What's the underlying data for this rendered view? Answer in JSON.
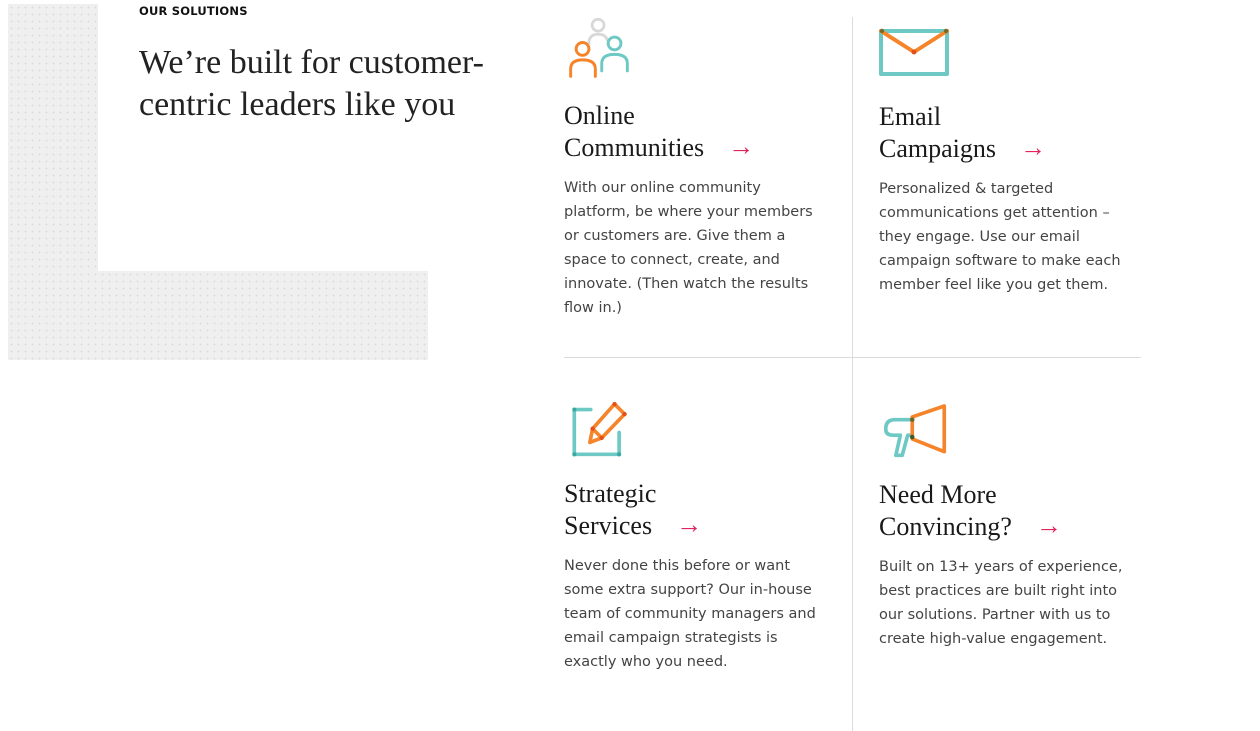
{
  "section": {
    "eyebrow": "OUR SOLUTIONS",
    "headline": "We’re built for customer-centric leaders like you"
  },
  "colors": {
    "accent_arrow": "#e0245e",
    "icon_orange": "#f5842a",
    "icon_teal": "#6ec9c4",
    "icon_grey": "#d8d8d8",
    "divider": "#dcdcdc"
  },
  "cards": [
    {
      "icon": "people-icon",
      "title_line1": "Online",
      "title_line2": "Communities",
      "arrow": "→",
      "body": "With our online community platform, be where your members or customers are. Give them a space to connect, create, and innovate. (Then watch the results flow in.)"
    },
    {
      "icon": "envelope-icon",
      "title_line1": "Email",
      "title_line2": "Campaigns",
      "arrow": "→",
      "body": "Personalized & targeted communications get attention – they engage. Use our email campaign software to make each member feel like you get them."
    },
    {
      "icon": "edit-pencil-icon",
      "title_line1": "Strategic",
      "title_line2": "Services",
      "arrow": "→",
      "body": "Never done this before or want some extra support? Our in-house team of community managers and email campaign strategists is exactly who you need."
    },
    {
      "icon": "megaphone-icon",
      "title_line1": "Need More",
      "title_line2": "Convincing?",
      "arrow": "→",
      "body": "Built on 13+ years of experience, best practices are built right into our solutions. Partner with us to create high-value engagement."
    }
  ]
}
